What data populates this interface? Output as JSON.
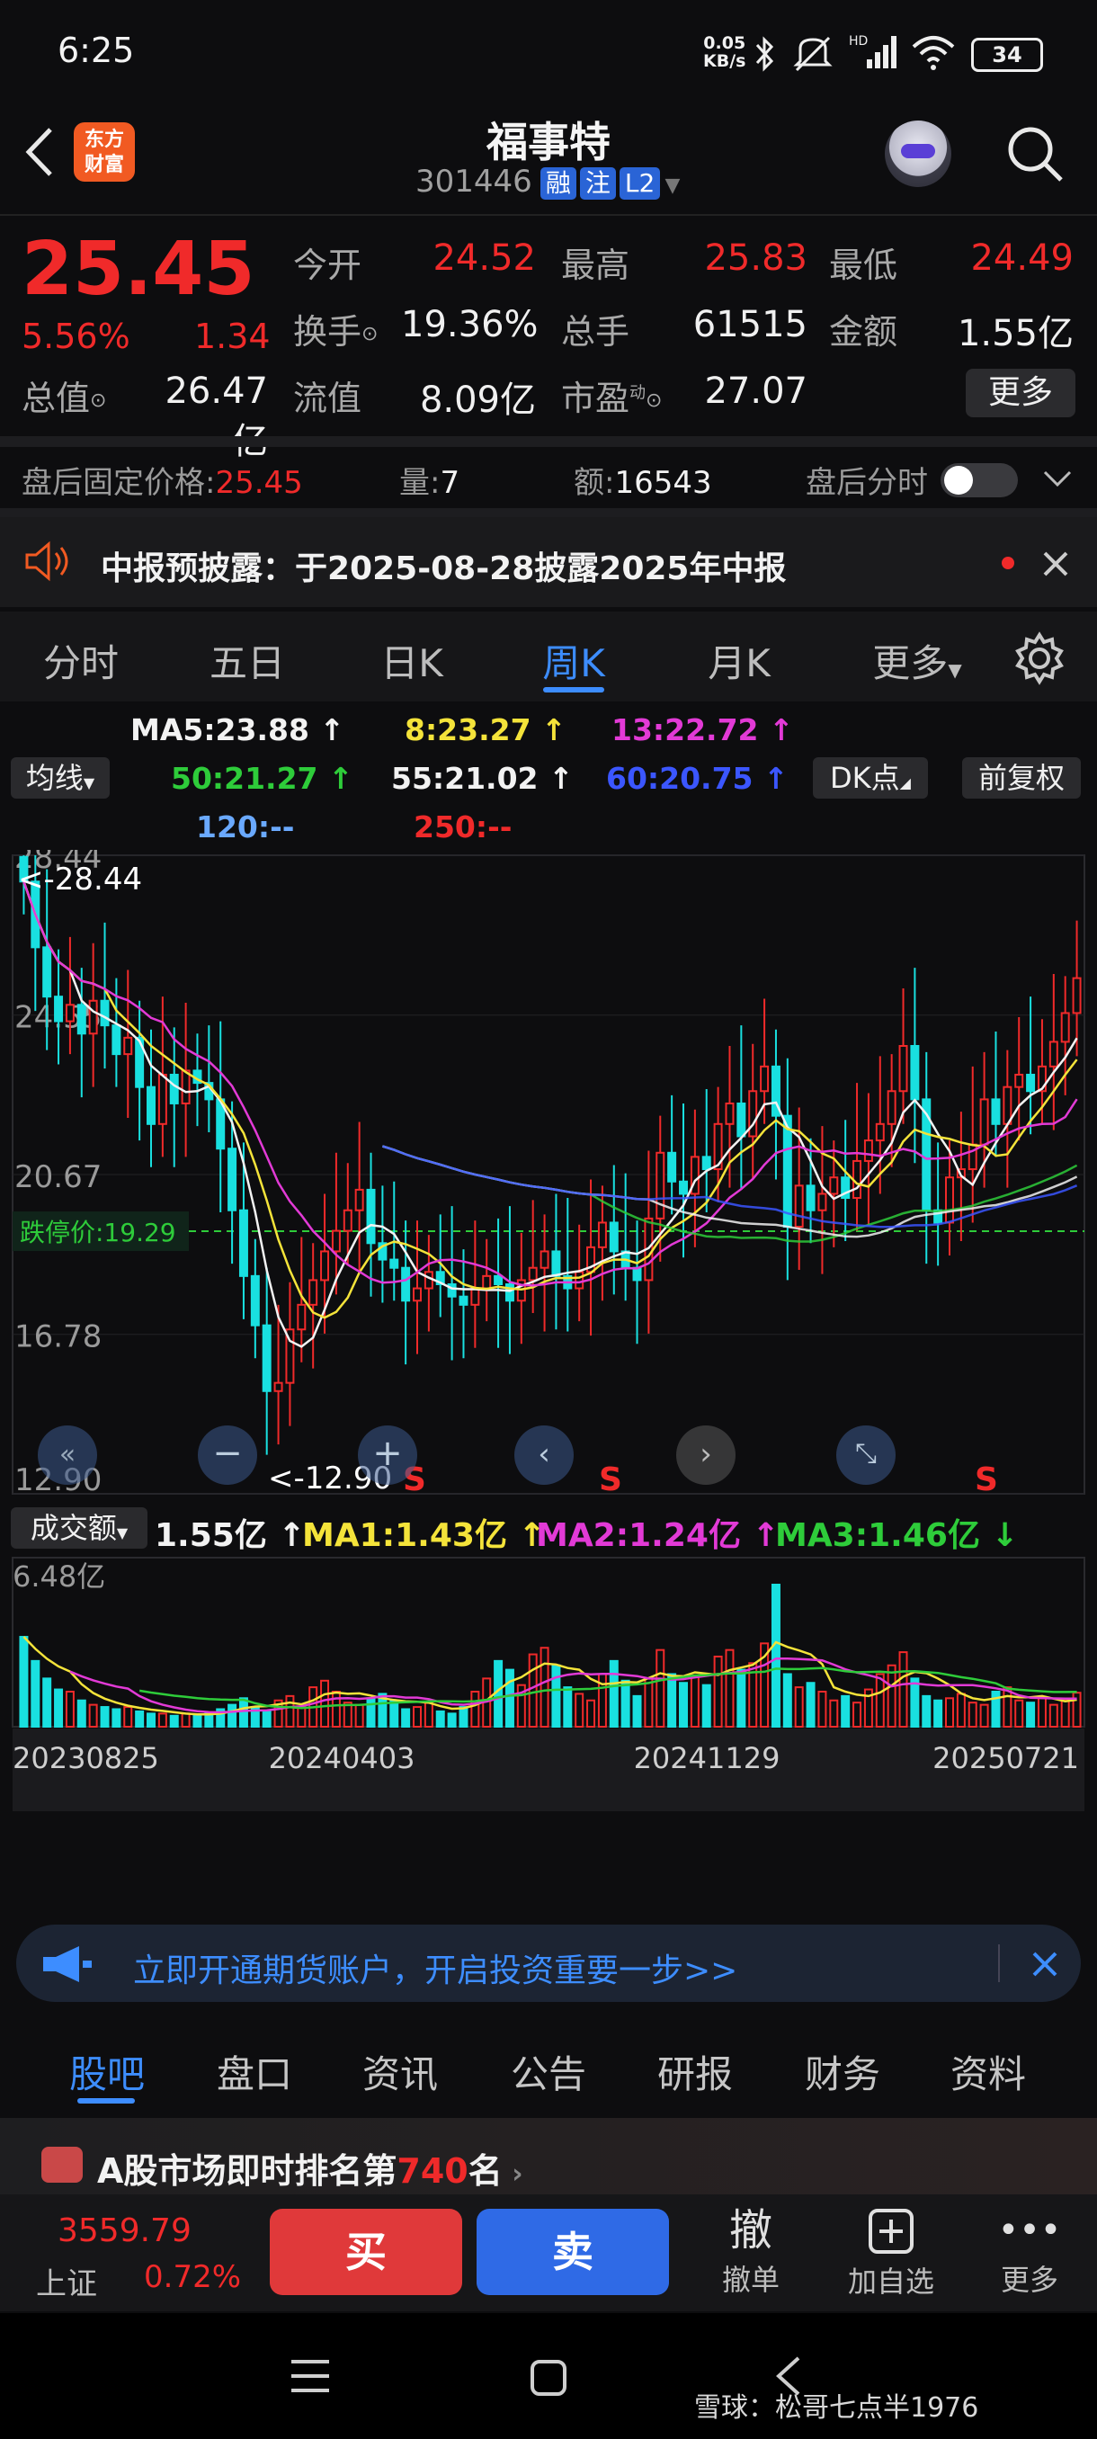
{
  "status": {
    "time": "6:25",
    "netspeed_top": "0.05",
    "netspeed_bottom": "KB/s",
    "battery": "34"
  },
  "header": {
    "logo_line1": "东方",
    "logo_line2": "财富",
    "name": "福事特",
    "code": "301446",
    "tags": [
      "融",
      "注",
      "L2"
    ]
  },
  "quote": {
    "price": "25.45",
    "pct": "5.56%",
    "chg": "1.34",
    "fields": [
      {
        "label": "今开",
        "value": "24.52",
        "color": "#f02a2a"
      },
      {
        "label": "最高",
        "value": "25.83",
        "color": "#f02a2a"
      },
      {
        "label": "最低",
        "value": "24.49",
        "color": "#f02a2a"
      },
      {
        "label": "换手",
        "value": "19.36%",
        "color": "#f0f0f0"
      },
      {
        "label": "总手",
        "value": "61515",
        "color": "#f0f0f0"
      },
      {
        "label": "金额",
        "value": "1.55亿",
        "color": "#f0f0f0"
      },
      {
        "label": "总值",
        "value": "26.47亿",
        "color": "#f0f0f0"
      },
      {
        "label": "流值",
        "value": "8.09亿",
        "color": "#f0f0f0"
      },
      {
        "label": "市盈",
        "value": "27.07",
        "color": "#f0f0f0"
      }
    ],
    "pe_superscript": "动",
    "more": "更多"
  },
  "afterhours": {
    "label": "盘后固定价格:",
    "price": "25.45",
    "vol_label": "量:",
    "vol": "7",
    "amt_label": "额:",
    "amt": "16543",
    "toggle_label": "盘后分时"
  },
  "notice": {
    "text": "中报预披露：于2025-08-28披露2025年中报"
  },
  "tabs": [
    "分时",
    "五日",
    "日K",
    "周K",
    "月K",
    "更多"
  ],
  "active_tab": 3,
  "ma_legend": {
    "selector": "均线",
    "items": [
      {
        "text": "MA5:23.88 ↑",
        "color": "#f2f2f2"
      },
      {
        "text": "8:23.27 ↑",
        "color": "#f4e33a"
      },
      {
        "text": "13:22.72 ↑",
        "color": "#e23ad6"
      },
      {
        "text": "50:21.27 ↑",
        "color": "#2ecc3a"
      },
      {
        "text": "55:21.02 ↑",
        "color": "#f2f2f2"
      },
      {
        "text": "60:20.75 ↑",
        "color": "#3b56ff"
      },
      {
        "text": "120:--",
        "color": "#6aa9ff"
      },
      {
        "text": "250:--",
        "color": "#f02a2a"
      }
    ],
    "dk": "DK点",
    "fq": "前复权"
  },
  "chart_data": [
    {
      "type": "candlestick",
      "y_ticks": [
        "28.44",
        "24.55",
        "20.67",
        "16.78",
        "12.90"
      ],
      "ylim": [
        12.9,
        28.44
      ],
      "high_marker": "<-28.44",
      "low_marker": "<-12.90",
      "limit_down_label": "跌停价:19.29",
      "limit_down": 19.29,
      "signals": [
        "S",
        "S",
        "S"
      ],
      "close": [
        27.8,
        26.2,
        25.0,
        24.4,
        24.8,
        24.1,
        24.9,
        24.3,
        23.6,
        24.0,
        22.8,
        21.9,
        23.1,
        22.4,
        23.2,
        22.9,
        22.5,
        21.3,
        19.8,
        18.2,
        17.0,
        15.4,
        15.6,
        16.9,
        17.5,
        18.1,
        18.8,
        19.3,
        19.8,
        20.3,
        19.0,
        18.6,
        18.4,
        17.6,
        17.9,
        18.3,
        18.0,
        17.7,
        17.5,
        17.9,
        18.2,
        18.0,
        17.6,
        18.1,
        18.4,
        18.8,
        18.2,
        17.9,
        18.3,
        18.9,
        19.5,
        18.8,
        18.4,
        18.1,
        19.6,
        21.2,
        20.5,
        20.2,
        21.1,
        20.8,
        21.9,
        22.4,
        21.6,
        22.7,
        23.3,
        22.1,
        19.4,
        20.4,
        19.8,
        20.2,
        20.6,
        20.1,
        21.0,
        21.5,
        21.9,
        22.7,
        23.8,
        22.5,
        19.8,
        19.5,
        20.6,
        20.8,
        21.4,
        22.5,
        21.9,
        22.8,
        23.1,
        22.7,
        23.3,
        23.9,
        24.6,
        25.45
      ],
      "volume_max_label": "6.48亿",
      "volume": [
        4.1,
        3.0,
        2.2,
        1.7,
        1.6,
        1.2,
        1.0,
        0.9,
        0.8,
        0.9,
        0.7,
        0.6,
        0.6,
        0.5,
        0.6,
        0.5,
        0.6,
        0.8,
        1.0,
        1.3,
        0.9,
        0.7,
        1.2,
        1.4,
        0.9,
        1.8,
        2.1,
        1.6,
        1.1,
        1.0,
        1.3,
        1.5,
        1.2,
        0.8,
        0.9,
        1.1,
        0.7,
        0.6,
        0.9,
        1.6,
        2.2,
        3.0,
        2.6,
        1.9,
        3.3,
        3.6,
        2.8,
        1.8,
        1.5,
        1.2,
        2.4,
        3.0,
        2.1,
        1.4,
        2.2,
        3.5,
        2.4,
        2.0,
        2.3,
        1.9,
        3.2,
        3.5,
        2.6,
        2.9,
        3.8,
        6.48,
        2.4,
        1.8,
        2.0,
        1.6,
        1.2,
        1.4,
        1.1,
        1.7,
        2.4,
        2.8,
        3.4,
        2.2,
        1.4,
        1.2,
        1.3,
        1.5,
        1.1,
        1.0,
        1.6,
        1.8,
        1.2,
        1.1,
        1.3,
        1.0,
        1.2,
        1.55
      ],
      "x_ticks": [
        "20230825",
        "20240403",
        "20241129",
        "20250721"
      ]
    }
  ],
  "volume_legend": {
    "selector": "成交额",
    "items": [
      {
        "text": "1.55亿 ↑",
        "color": "#f2f2f2"
      },
      {
        "text": "MA1:1.43亿 ↑",
        "color": "#f4e33a"
      },
      {
        "text": "MA2:1.24亿 ↑",
        "color": "#e23ad6"
      },
      {
        "text": "MA3:1.46亿 ↓",
        "color": "#2ecc3a"
      }
    ]
  },
  "banner": {
    "text": "立即开通期货账户，开启投资重要一步>>"
  },
  "subtabs": [
    "股吧",
    "盘口",
    "资讯",
    "公告",
    "研报",
    "财务",
    "资料"
  ],
  "rank": {
    "prefix": "A股市场即时排名第",
    "num": "740",
    "suffix": "名"
  },
  "index": {
    "value": "3559.79",
    "name": "上证",
    "pct": "0.72%"
  },
  "actions": {
    "buy": "买",
    "sell": "卖",
    "cancel": "撤",
    "cancel_label": "撤单",
    "add_label": "加自选",
    "more_label": "更多"
  },
  "watermark": "雪球：松哥七点半1976"
}
